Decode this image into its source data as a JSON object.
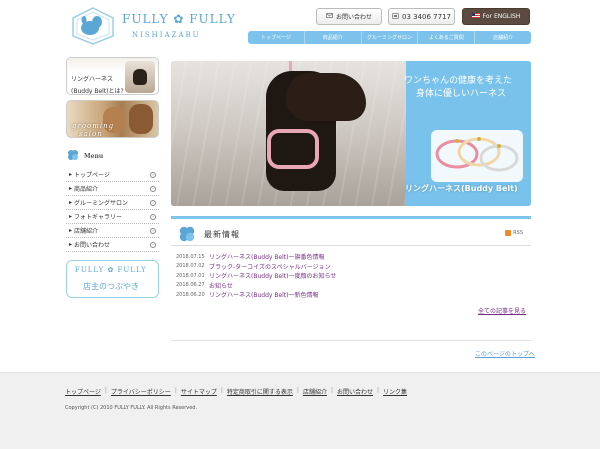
{
  "header": {
    "logo_title": "FULLY ✿ FULLY",
    "logo_sub": "NISHIAZABU",
    "contact_label": "お問い合わせ",
    "phone_label": "03 3406 7717",
    "english_label": "For ENGLISH"
  },
  "gnav": [
    "トップページ",
    "商品紹介",
    "グルーミングサロン",
    "よくあるご質問",
    "店舗紹介"
  ],
  "banners": {
    "b1_line1": "リングハーネス",
    "b1_line2": "(Buddy Belt)とは?",
    "b2_word1": "grooming",
    "b2_word2": "salon"
  },
  "side_menu": {
    "title": "Menu",
    "items": [
      "トップページ",
      "商品紹介",
      "グルーミングサロン",
      "フォトギャラリー",
      "店舗紹介",
      "お問い合わせ"
    ]
  },
  "blog_banner": {
    "title": "FULLY ✿ FULLY",
    "subtitle": "店主のつぶやき"
  },
  "hero": {
    "catch1": "ワンちゃんの健康を考えた",
    "catch2": "身体に優しいハーネス",
    "product_title": "リングハーネス(Buddy Belt)"
  },
  "news": {
    "title": "最新情報",
    "rss": "RSS",
    "items": [
      {
        "date": "2018.07.15",
        "title": "リングハーネス(Buddy Belt)一旗番色情報"
      },
      {
        "date": "2018.07.02",
        "title": "ブラック-ターコイズのスペシャルバージョン"
      },
      {
        "date": "2018.07.01",
        "title": "リングハーネス(Buddy Belt)一度顔のお知らせ"
      },
      {
        "date": "2018.06.27",
        "title": "お知らせ"
      },
      {
        "date": "2018.06.20",
        "title": "リングハーネス(Buddy Belt)一新色情報"
      }
    ],
    "more": "全ての記事を見る"
  },
  "pagetop": "このページのトップへ",
  "footer": {
    "links": [
      "トップページ",
      "プライバシーポリシー",
      "サイトマップ",
      "特定商取引に関する表示",
      "店舗紹介",
      "お問い合わせ",
      "リンク集"
    ],
    "copyright": "Copyright (C) 2010 FULLY FULLY. All Rights Reserved."
  },
  "colors": {
    "brand_blue": "#7cc2ea",
    "link_purple": "#7b2f8c",
    "english_btn": "#5a4a3f"
  }
}
